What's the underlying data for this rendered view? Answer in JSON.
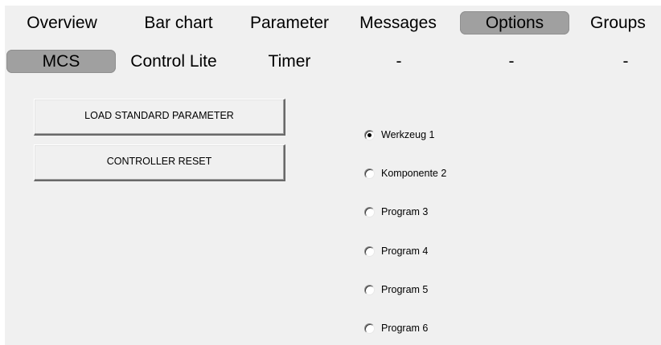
{
  "tabs_row1": [
    {
      "label": "Overview",
      "active": false
    },
    {
      "label": "Bar chart",
      "active": false
    },
    {
      "label": "Parameter",
      "active": false
    },
    {
      "label": "Messages",
      "active": false
    },
    {
      "label": "Options",
      "active": true
    },
    {
      "label": "Groups",
      "active": false
    }
  ],
  "tabs_row2": [
    {
      "label": "MCS",
      "active": true
    },
    {
      "label": "Control Lite",
      "active": false
    },
    {
      "label": "Timer",
      "active": false
    },
    {
      "label": "-",
      "active": false
    },
    {
      "label": "-",
      "active": false
    },
    {
      "label": "-",
      "active": false
    }
  ],
  "buttons": {
    "load_standard": "LOAD STANDARD PARAMETER",
    "controller_reset": "CONTROLLER RESET"
  },
  "radio_options": [
    {
      "label": "Werkzeug 1",
      "checked": true
    },
    {
      "label": "Komponente 2",
      "checked": false
    },
    {
      "label": "Program 3",
      "checked": false
    },
    {
      "label": "Program 4",
      "checked": false
    },
    {
      "label": "Program 5",
      "checked": false
    },
    {
      "label": "Program 6",
      "checked": false
    }
  ],
  "colors": {
    "panel_background": "#f0f0f0",
    "active_tab": "#a0a0a0"
  }
}
